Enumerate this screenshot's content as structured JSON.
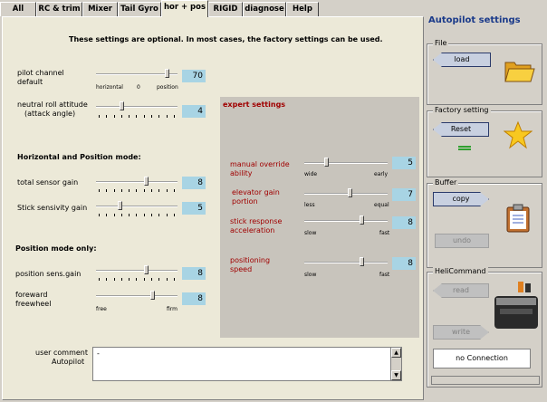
{
  "tabs": [
    "All",
    "RC & trim",
    "Mixer",
    "Tail Gyro",
    "hor + pos",
    "RIGID",
    "diagnose",
    "Help"
  ],
  "active_tab": "hor + pos",
  "notice": "These settings are optional. In most cases, the factory settings can be used.",
  "pilot_channel": {
    "label_1": "pilot channel",
    "label_2": "default",
    "value": "70",
    "left": "horizontal",
    "mid": "0",
    "right": "position"
  },
  "neutral_roll": {
    "label_1": "neutral roll attitude",
    "label_2": "(attack angle)",
    "value": "4"
  },
  "horiz_heading": "Horizontal  and  Position mode:",
  "total_sensor": {
    "label": "total sensor gain",
    "value": "8"
  },
  "stick_sens": {
    "label": "Stick sensivity gain",
    "value": "5"
  },
  "pos_heading": "Position mode  only:",
  "pos_sens": {
    "label": "position sens.gain",
    "value": "8"
  },
  "freewheel": {
    "label_1": "foreward",
    "label_2": "freewheel",
    "value": "8",
    "left": "free",
    "right": "firm"
  },
  "expert": {
    "title": "expert settings",
    "override": {
      "label_1": "manual override",
      "label_2": "ability",
      "value": "5",
      "left": "wide",
      "right": "early"
    },
    "elevator": {
      "label_1": "elevator gain",
      "label_2": "portion",
      "value": "7",
      "left": "less",
      "right": "equal"
    },
    "stick_resp": {
      "label_1": "stick response",
      "label_2": "acceleration",
      "value": "8",
      "left": "slow",
      "right": "fast"
    },
    "positioning": {
      "label_1": "positioning",
      "label_2": "speed",
      "value": "8",
      "left": "slow",
      "right": "fast"
    }
  },
  "comment": {
    "label_1": "user comment",
    "label_2": "Autopilot",
    "value": "-"
  },
  "panel": {
    "title": "Autopilot settings",
    "file": {
      "title": "File",
      "load": "load"
    },
    "factory": {
      "title": "Factory setting",
      "reset": "Reset"
    },
    "buffer": {
      "title": "Buffer",
      "copy": "copy",
      "undo": "undo"
    },
    "heli": {
      "title": "HeliCommand",
      "read": "read",
      "write": "write",
      "status": "no Connection"
    }
  },
  "levels": {
    "pilot": 0.89,
    "roll": 0.3,
    "total": 0.62,
    "stick": 0.28,
    "pos": 0.62,
    "free": 0.7,
    "override": 0.25,
    "elevator": 0.55,
    "stickresp": 0.7,
    "positioning": 0.7
  },
  "colors": {
    "accent": "#1a3a8a",
    "value_bg": "#a8d4e4",
    "expert_text": "#a00000"
  }
}
